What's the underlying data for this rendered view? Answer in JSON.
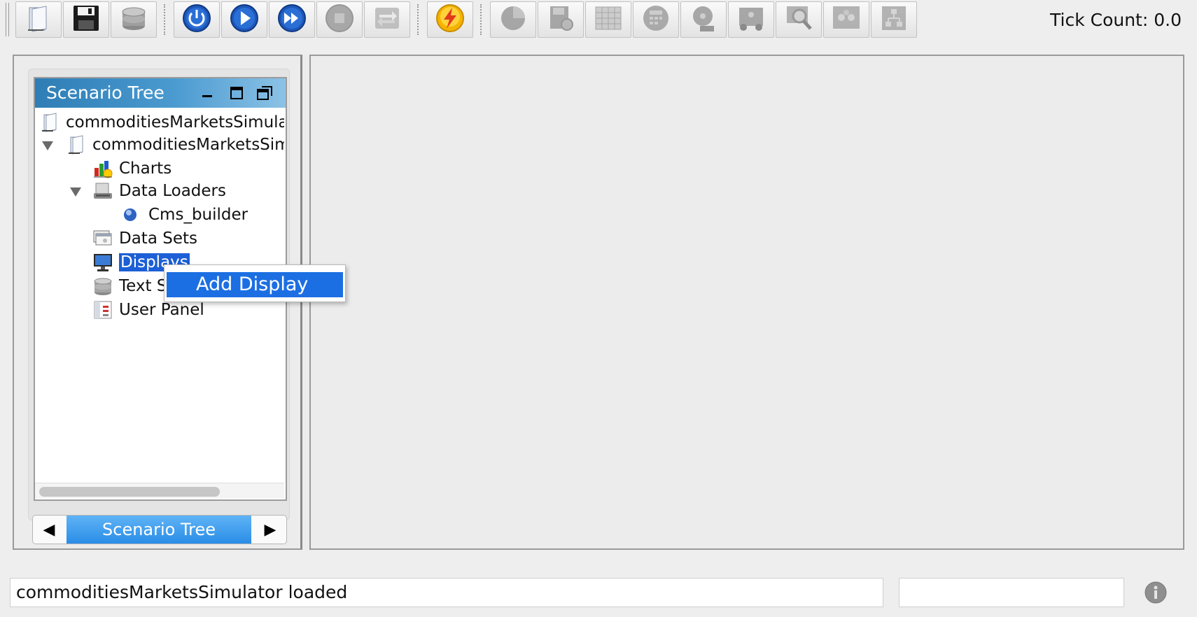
{
  "toolbar": {
    "buttons": [
      {
        "name": "open-scenario",
        "icon": "folder-document-icon",
        "enabled": true
      },
      {
        "name": "save-scenario",
        "icon": "floppy-disk-icon",
        "enabled": true
      },
      {
        "name": "database",
        "icon": "database-stack-icon",
        "enabled": true
      },
      {
        "name": "initialize",
        "icon": "power-icon",
        "enabled": true
      },
      {
        "name": "start",
        "icon": "play-icon",
        "enabled": true
      },
      {
        "name": "step",
        "icon": "fast-forward-icon",
        "enabled": true
      },
      {
        "name": "stop",
        "icon": "stop-icon",
        "enabled": false
      },
      {
        "name": "reset",
        "icon": "reset-arrows-icon",
        "enabled": false
      },
      {
        "name": "run-batch",
        "icon": "lightning-icon",
        "enabled": true
      },
      {
        "name": "pie-chart",
        "icon": "pie-chart-icon",
        "enabled": false
      },
      {
        "name": "save-settings",
        "icon": "disk-gear-icon",
        "enabled": false
      },
      {
        "name": "spreadsheet",
        "icon": "spreadsheet-icon",
        "enabled": false
      },
      {
        "name": "calculator",
        "icon": "calculator-icon",
        "enabled": false
      },
      {
        "name": "movie",
        "icon": "film-reel-icon",
        "enabled": false
      },
      {
        "name": "network",
        "icon": "network-icon",
        "enabled": false
      },
      {
        "name": "zoom",
        "icon": "magnifier-icon",
        "enabled": false
      },
      {
        "name": "agents",
        "icon": "agents-icon",
        "enabled": false
      },
      {
        "name": "flow",
        "icon": "flow-icon",
        "enabled": false
      }
    ],
    "tick_count": "Tick Count: 0.0"
  },
  "scenario_tree": {
    "title": "Scenario Tree",
    "items": [
      {
        "label": "commoditiesMarketsSimula",
        "icon": "scenario-file-icon",
        "level": 0,
        "expanded": null
      },
      {
        "label": "commoditiesMarketsSim",
        "icon": "scenario-file-icon",
        "level": 1,
        "expanded": true
      },
      {
        "label": "Charts",
        "icon": "chart-icon",
        "level": 2,
        "expanded": null
      },
      {
        "label": "Data Loaders",
        "icon": "data-loader-icon",
        "level": 2,
        "expanded": true
      },
      {
        "label": "Cms_builder",
        "icon": "blue-dot-icon",
        "level": 3,
        "expanded": null
      },
      {
        "label": "Data Sets",
        "icon": "data-sets-icon",
        "level": 2,
        "expanded": null
      },
      {
        "label": "Displays",
        "icon": "monitor-icon",
        "level": 2,
        "expanded": null,
        "selected": true
      },
      {
        "label": "Text Sinks",
        "icon": "text-sink-icon",
        "level": 2,
        "expanded": null
      },
      {
        "label": "User Panel",
        "icon": "user-panel-icon",
        "level": 2,
        "expanded": null
      }
    ],
    "tab_label": "Scenario Tree"
  },
  "context_menu": {
    "items": [
      "Add Display"
    ]
  },
  "status_bar": {
    "message": "commoditiesMarketsSimulator loaded",
    "aux": "",
    "info_icon": "info-icon"
  },
  "colors": {
    "title_bar": "#2e7eb5",
    "selection": "#1c5fd6",
    "menu_highlight": "#1c6fe2",
    "tab_active": "#2a8de6"
  }
}
